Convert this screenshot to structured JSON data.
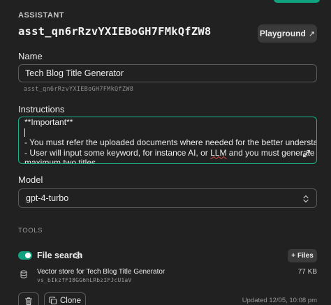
{
  "header": {
    "section_label": "ASSISTANT",
    "assistant_id": "asst_qn6rRzvYXIEBoGH7FMkQfZW8",
    "playground_label": "Playground",
    "playground_icon": "arrow-up-right-icon"
  },
  "name": {
    "label": "Name",
    "value": "Tech Blog Title Generator",
    "sub_id": "asst_qn6rRzvYXIEBoGH7FMkQfZW8"
  },
  "instructions": {
    "label": "Instructions",
    "line1": "**Important**",
    "line3": "- You must refer the uploaded documents where needed for the better understanding.",
    "line4_pre": "- User will input some keyword, for instance AI, or ",
    "line4_llm": "LLM",
    "line4_post": " and you must generate",
    "line5": "maximum two titles"
  },
  "model": {
    "label": "Model",
    "value": "gpt-4-turbo"
  },
  "tools": {
    "label": "TOOLS",
    "file_search_label": "File search",
    "file_search_enabled": true,
    "files_button_label": "Files",
    "vector_store_name": "Vector store for Tech Blog Title Generator",
    "vector_store_id": "vs_bIkzfFI8GG6hLRbzIFJcU1aV",
    "vector_store_size": "77 KB"
  },
  "footer": {
    "clone_label": "Clone",
    "updated_text": "Updated 12/05, 10:08 pm"
  },
  "colors": {
    "accent": "#10a37f",
    "focus_border": "#18b48a",
    "background": "#212121"
  }
}
